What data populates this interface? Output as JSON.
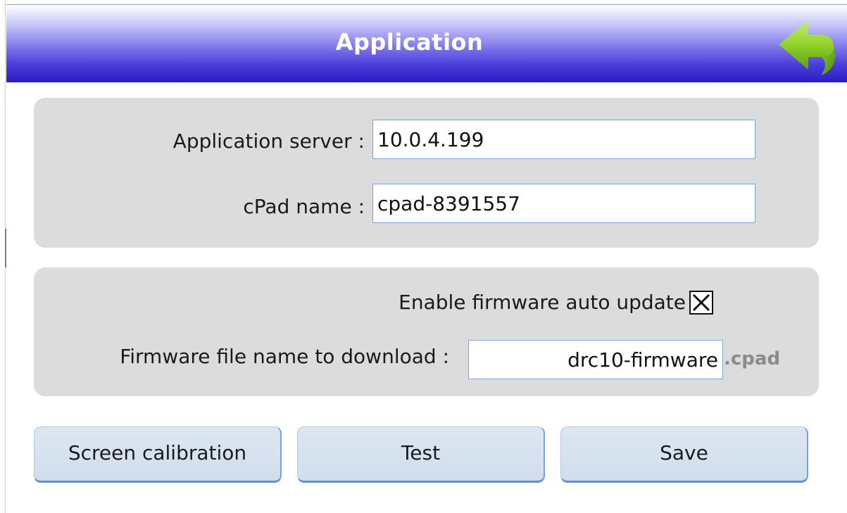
{
  "header": {
    "title": "Application",
    "back_icon": "back-arrow-icon",
    "back_icon_color": "#7dc81e"
  },
  "app_server": {
    "label": "Application server :",
    "value": "10.0.4.199"
  },
  "cpad_name": {
    "label": "cPad name :",
    "value": "cpad-8391557"
  },
  "firmware": {
    "auto_update_label": "Enable firmware auto update",
    "auto_update_checked": true,
    "checkbox_icon": "x-mark-icon",
    "file_label": "Firmware file name to download :",
    "file_value": "drc10-firmware",
    "file_suffix": ".cpad"
  },
  "buttons": {
    "calibration": "Screen calibration",
    "test": "Test",
    "save": "Save"
  },
  "colors": {
    "header_top": "#ffffff",
    "header_bottom": "#2a1bc4",
    "panel_bg": "#dcdcdc",
    "button_bg": "#d6e1ee",
    "field_border": "#7ea2d6"
  }
}
